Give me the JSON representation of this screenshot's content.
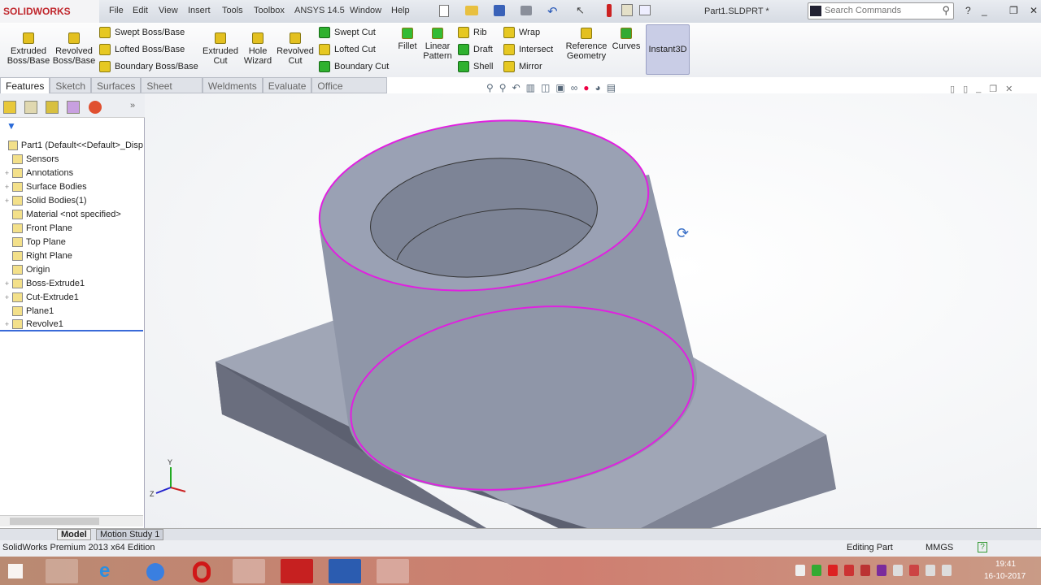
{
  "app": {
    "brand": "SOLIDWORKS",
    "filename": "Part1.SLDPRT *",
    "search_placeholder": "Search Commands"
  },
  "menu": [
    "File",
    "Edit",
    "View",
    "Insert",
    "Tools",
    "Toolbox",
    "ANSYS 14.5",
    "Window",
    "Help"
  ],
  "commands": {
    "big": [
      {
        "l1": "Extruded",
        "l2": "Boss/Base"
      },
      {
        "l1": "Revolved",
        "l2": "Boss/Base"
      },
      {
        "l1": "Extruded",
        "l2": "Cut"
      },
      {
        "l1": "Hole",
        "l2": "Wizard"
      },
      {
        "l1": "Revolved",
        "l2": "Cut"
      },
      {
        "l1": "Fillet",
        "l2": ""
      },
      {
        "l1": "Linear",
        "l2": "Pattern"
      },
      {
        "l1": "Reference",
        "l2": "Geometry"
      },
      {
        "l1": "Curves",
        "l2": ""
      }
    ],
    "boss_small": [
      "Swept Boss/Base",
      "Lofted Boss/Base",
      "Boundary Boss/Base"
    ],
    "cut_small": [
      "Swept Cut",
      "Lofted Cut",
      "Boundary Cut"
    ],
    "feat_small": [
      "Rib",
      "Draft",
      "Shell"
    ],
    "feat_small2": [
      "Wrap",
      "Intersect",
      "Mirror"
    ],
    "instant3d": "Instant3D"
  },
  "tabs": [
    "Features",
    "Sketch",
    "Surfaces",
    "Sheet Metal",
    "Weldments",
    "Evaluate",
    "Office Products"
  ],
  "tree": [
    {
      "label": "Part1  (Default<<Default>_Disp",
      "expand": ""
    },
    {
      "label": "Sensors",
      "expand": ""
    },
    {
      "label": "Annotations",
      "expand": "+"
    },
    {
      "label": "Surface Bodies",
      "expand": "+"
    },
    {
      "label": "Solid Bodies(1)",
      "expand": "+"
    },
    {
      "label": "Material <not specified>",
      "expand": ""
    },
    {
      "label": "Front Plane",
      "expand": ""
    },
    {
      "label": "Top Plane",
      "expand": ""
    },
    {
      "label": "Right Plane",
      "expand": ""
    },
    {
      "label": "Origin",
      "expand": ""
    },
    {
      "label": "Boss-Extrude1",
      "expand": "+"
    },
    {
      "label": "Cut-Extrude1",
      "expand": "+"
    },
    {
      "label": "Plane1",
      "expand": ""
    },
    {
      "label": "Revolve1",
      "expand": "+"
    }
  ],
  "bottom_tabs": [
    "Model",
    "Motion Study 1"
  ],
  "status": {
    "edition": "SolidWorks Premium 2013 x64 Edition",
    "mode": "Editing Part",
    "units": "MMGS"
  },
  "triad": {
    "y": "Y",
    "z": "Z"
  },
  "taskbar": {
    "time": "19:41",
    "date": "16-10-2017"
  },
  "colors": {
    "edge_highlight": "#e020e0",
    "model": "#8f96a8",
    "selected_tab": "#ffffff"
  }
}
